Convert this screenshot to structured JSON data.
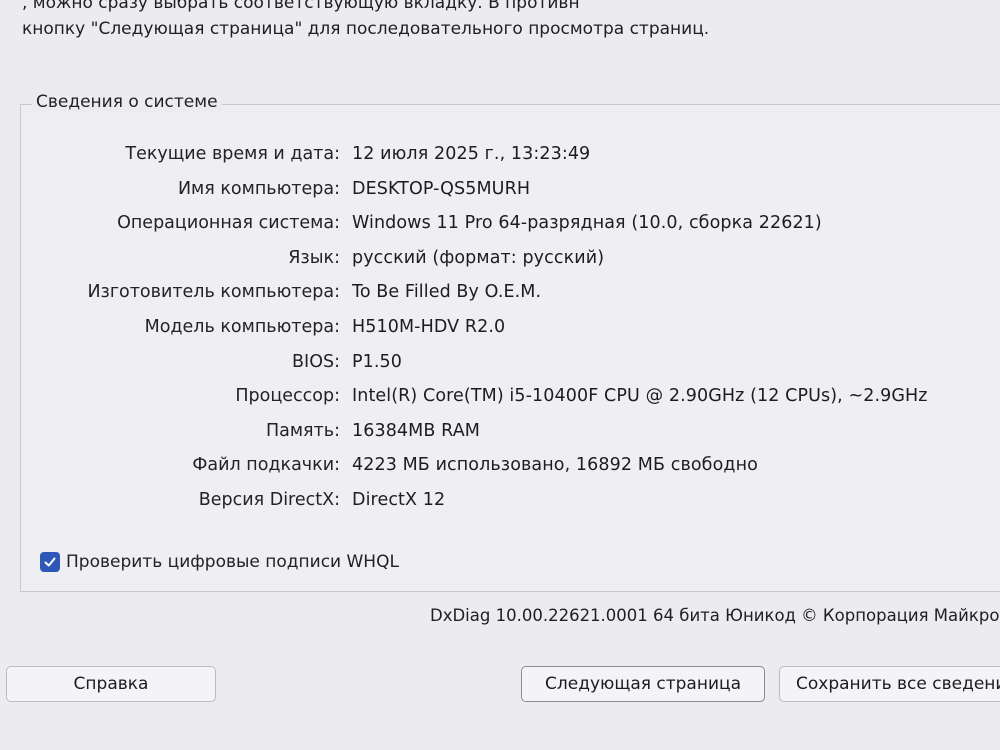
{
  "intro_text": {
    "line1": "                     , можно сразу выбрать соответствующую вкладку. В противн",
    "line2": "кнопку \"Следующая страница\" для последовательного просмотра страниц."
  },
  "system_info": {
    "title": "Сведения о системе",
    "rows": [
      {
        "label": "Текущие время и дата:",
        "value": "12 июля 2025 г., 13:23:49"
      },
      {
        "label": "Имя компьютера:",
        "value": "DESKTOP-QS5MURH"
      },
      {
        "label": "Операционная система:",
        "value": "Windows 11 Pro 64-разрядная (10.0, сборка 22621)"
      },
      {
        "label": "Язык:",
        "value": "русский (формат: русский)"
      },
      {
        "label": "Изготовитель компьютера:",
        "value": "To Be Filled By O.E.M."
      },
      {
        "label": "Модель компьютера:",
        "value": "H510M-HDV R2.0"
      },
      {
        "label": "BIOS:",
        "value": "P1.50"
      },
      {
        "label": "Процессор:",
        "value": "Intel(R) Core(TM) i5-10400F CPU @ 2.90GHz (12 CPUs), ~2.9GHz"
      },
      {
        "label": "Память:",
        "value": "16384MB RAM"
      },
      {
        "label": "Файл подкачки:",
        "value": "4223 МБ использовано, 16892 МБ свободно"
      },
      {
        "label": "Версия DirectX:",
        "value": "DirectX 12"
      }
    ]
  },
  "whql_checkbox": {
    "label": "Проверить цифровые подписи WHQL",
    "checked": true
  },
  "version_text": "DxDiag 10.00.22621.0001 64 бита Юникод © Корпорация Майкро",
  "buttons": {
    "help": "Справка",
    "next_page": "Следующая страница",
    "save_all": "Сохранить все сведения"
  },
  "colors": {
    "background": "#ecebf0",
    "checkbox_accent": "#2f57b8"
  }
}
